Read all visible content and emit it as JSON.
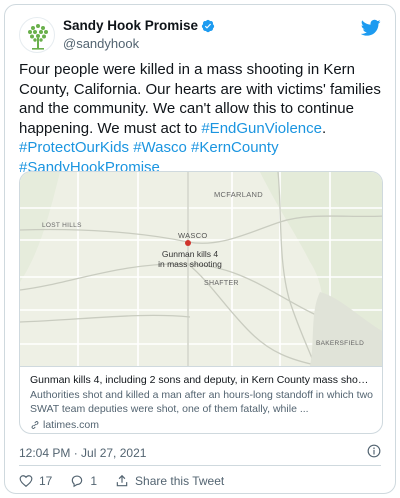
{
  "author": {
    "display_name": "Sandy Hook Promise",
    "handle": "@sandyhook"
  },
  "tweet": {
    "text_main": "Four people were killed in a mass shooting in Kern County, California. Our hearts are with victims' families and the community. We can't allow this to continue happening. We must act to ",
    "hashtags_inline": "#EndGunViolence",
    "text_period": ".",
    "hashtags_line2": "#ProtectOurKids #Wasco #KernCounty",
    "hashtags_line3": "#SandyHookPromise",
    "timestamp": "12:04 PM · Jul 27, 2021"
  },
  "card": {
    "map_labels": {
      "mcfarland": "MCFARLAND",
      "lost_hills": "LOST HILLS",
      "wasco": "WASCO",
      "gunman": "Gunman kills 4",
      "gunman2": "in mass shooting",
      "shafter": "SHAFTER",
      "bakersfield": "BAKERSFIELD"
    },
    "title": "Gunman kills 4, including 2 sons and deputy, in Kern County mass shoot...",
    "description": "Authorities shot and killed a man after an hours-long standoff in which two SWAT team deputies were shot, one of them fatally, while ...",
    "domain": "latimes.com"
  },
  "actions": {
    "likes": "17",
    "replies": "1",
    "share_label": "Share this Tweet"
  },
  "colors": {
    "link": "#1b95e0",
    "heart": "#536471",
    "twitter_blue": "#1d9bf0",
    "logo_green": "#6ab04c"
  },
  "icons": [
    "sandy-hook-tree-logo",
    "verified-badge-icon",
    "twitter-bird-icon",
    "link-icon",
    "info-icon",
    "heart-icon",
    "reply-icon",
    "share-icon"
  ]
}
